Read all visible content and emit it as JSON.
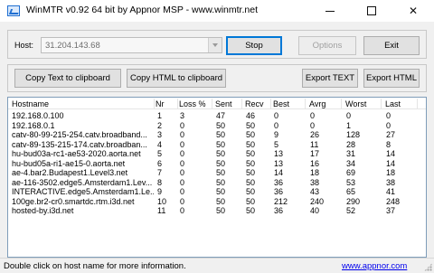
{
  "window": {
    "title": "WinMTR v0.92 64 bit by Appnor MSP - www.winmtr.net"
  },
  "controls": {
    "host_label": "Host:",
    "host_value": "31.204.143.68",
    "stop": "Stop",
    "options": "Options",
    "exit": "Exit",
    "copy_text": "Copy Text to clipboard",
    "copy_html": "Copy HTML to clipboard",
    "export_text": "Export TEXT",
    "export_html": "Export HTML"
  },
  "table": {
    "columns": [
      "Hostname",
      "Nr",
      "Loss %",
      "Sent",
      "Recv",
      "Best",
      "Avrg",
      "Worst",
      "Last"
    ],
    "rows": [
      [
        "192.168.0.100",
        "1",
        "3",
        "47",
        "46",
        "0",
        "0",
        "0",
        "0"
      ],
      [
        "192.168.0.1",
        "2",
        "0",
        "50",
        "50",
        "0",
        "0",
        "1",
        "0"
      ],
      [
        "catv-80-99-215-254.catv.broadband...",
        "3",
        "0",
        "50",
        "50",
        "9",
        "26",
        "128",
        "27"
      ],
      [
        "catv-89-135-215-174.catv.broadban...",
        "4",
        "0",
        "50",
        "50",
        "5",
        "11",
        "28",
        "8"
      ],
      [
        "hu-bud03a-rc1-ae53-2020.aorta.net",
        "5",
        "0",
        "50",
        "50",
        "13",
        "17",
        "31",
        "14"
      ],
      [
        "hu-bud05a-ri1-ae15-0.aorta.net",
        "6",
        "0",
        "50",
        "50",
        "13",
        "16",
        "34",
        "14"
      ],
      [
        "ae-4.bar2.Budapest1.Level3.net",
        "7",
        "0",
        "50",
        "50",
        "14",
        "18",
        "69",
        "18"
      ],
      [
        "ae-116-3502.edge5.Amsterdam1.Lev...",
        "8",
        "0",
        "50",
        "50",
        "36",
        "38",
        "53",
        "38"
      ],
      [
        "INTERACTIVE.edge5.Amsterdam1.Le...",
        "9",
        "0",
        "50",
        "50",
        "36",
        "43",
        "65",
        "41"
      ],
      [
        "100ge.br2-cr0.smartdc.rtm.i3d.net",
        "10",
        "0",
        "50",
        "50",
        "212",
        "240",
        "290",
        "248"
      ],
      [
        "hosted-by.i3d.net",
        "11",
        "0",
        "50",
        "50",
        "36",
        "40",
        "52",
        "37"
      ]
    ]
  },
  "status": {
    "text": "Double click on host name for more information.",
    "link": "www.appnor.com"
  }
}
